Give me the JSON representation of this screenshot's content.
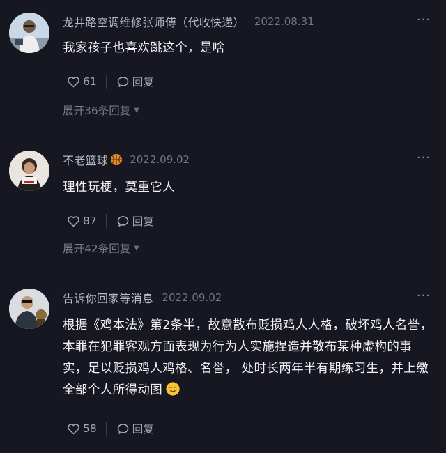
{
  "comments": [
    {
      "username": "龙井路空调维修张师傅（代收快递）",
      "date": "2022.08.31",
      "more": "···",
      "text": "我家孩子也喜欢跳这个，是啥",
      "likes": "61",
      "reply_label": "回复",
      "expand_label": "展开36条回复"
    },
    {
      "username": "不老篮球",
      "badge_icon": "basketball-icon",
      "date": "2022.09.02",
      "more": "···",
      "text": "理性玩梗，莫重它人",
      "likes": "87",
      "reply_label": "回复",
      "expand_label": "展开42条回复"
    },
    {
      "username": "告诉你回家等消息",
      "date": "2022.09.02",
      "more": "···",
      "text": "根据《鸡本法》第2条半，故意散布贬损鸡人人格，破坏鸡人名誉，本罪在犯罪客观方面表现为行为人实施捏造并散布某种虚构的事实，足以贬损鸡人鸡格、名誉， 处时长两年半有期练习生，并上缴全部个人所得动图",
      "emoji_icon": "smiling-face-emoji",
      "likes": "58",
      "reply_label": "回复"
    }
  ],
  "colors": {
    "background": "#161721",
    "username": "#b9bac2",
    "date": "#75767f",
    "text": "#f1f1f5"
  }
}
